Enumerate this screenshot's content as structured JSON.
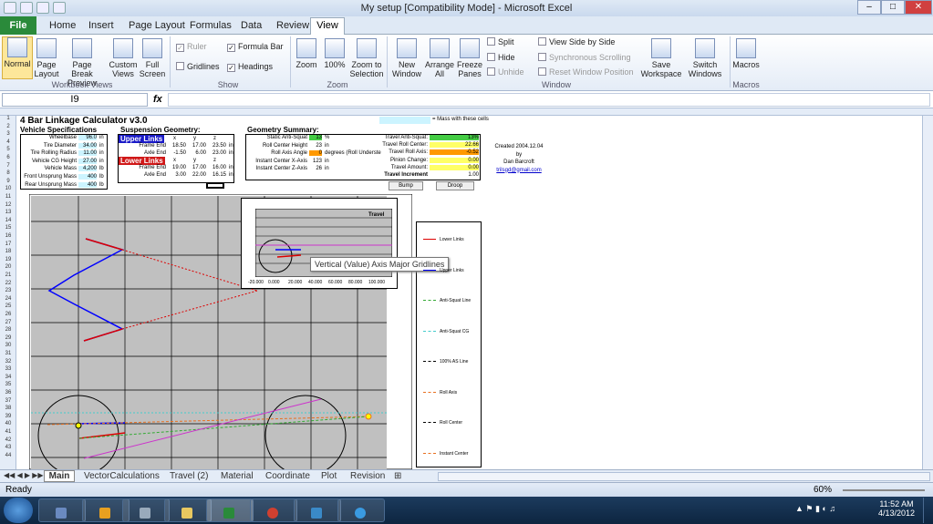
{
  "window": {
    "title": "My setup  [Compatibility Mode] - Microsoft Excel"
  },
  "ribbon_tabs": [
    "Home",
    "Insert",
    "Page Layout",
    "Formulas",
    "Data",
    "Review"
  ],
  "file_tab": "File",
  "active_tab": "View",
  "workbook_views": {
    "normal": "Normal",
    "page_layout": "Page Layout",
    "page_break": "Page Break Preview",
    "custom_views": "Custom Views",
    "full_screen": "Full Screen",
    "group": "Workbook Views"
  },
  "show": {
    "ruler": "Ruler",
    "formula_bar": "Formula Bar",
    "gridlines": "Gridlines",
    "headings": "Headings",
    "group": "Show"
  },
  "zoom": {
    "zoom": "Zoom",
    "z100": "100%",
    "zoom_sel": "Zoom to Selection",
    "group": "Zoom"
  },
  "window_grp": {
    "new_window": "New Window",
    "arrange_all": "Arrange All",
    "freeze": "Freeze Panes",
    "split": "Split",
    "hide": "Hide",
    "unhide": "Unhide",
    "side_by_side": "View Side by Side",
    "sync": "Synchronous Scrolling",
    "reset": "Reset Window Position",
    "save_ws": "Save Workspace",
    "switch": "Switch Windows",
    "group": "Window"
  },
  "macros": {
    "label": "Macros",
    "group": "Macros"
  },
  "namebox": "I9",
  "fx": "fx",
  "sheet": {
    "title": "4 Bar Linkage Calculator v3.0",
    "mass_note": "= Mass with these cells",
    "veh_hdr": "Vehicle Specifications",
    "veh": [
      [
        "Wheelbase",
        "96.0",
        "in"
      ],
      [
        "Tire Diameter",
        "34.00",
        "in"
      ],
      [
        "Tire Rolling Radius",
        "11.00",
        "in"
      ],
      [
        "Vehicle CG Height",
        "27.00",
        "in"
      ],
      [
        "Vehicle Mass",
        "4,200",
        "lb"
      ],
      [
        "Front Unsprung Mass",
        "400",
        "lb"
      ],
      [
        "Rear Unsprung Mass",
        "400",
        "lb"
      ]
    ],
    "susp_hdr": "Suspension Geometry:",
    "upper": "Upper Links",
    "lower": "Lower Links",
    "xyz": [
      "x",
      "y",
      "z"
    ],
    "upper_rows": [
      [
        "Frame End",
        "18.50",
        "17.00",
        "23.50"
      ],
      [
        "Axle End",
        "-1.50",
        "6.00",
        "23.00"
      ]
    ],
    "lower_rows": [
      [
        "Frame End",
        "19.00",
        "17.00",
        "16.00"
      ],
      [
        "Axle End",
        "3.00",
        "22.00",
        "16.15"
      ]
    ],
    "unit_in": "in",
    "geo_hdr": "Geometry Summary:",
    "geo": [
      [
        "Static Anti-Squat",
        "13",
        "%"
      ],
      [
        "Roll Center Height",
        "23",
        "in"
      ],
      [
        "Roll Axis Angle",
        "0",
        "degrees (Roll Underste"
      ],
      [
        "Instant Center X-Axis",
        "123",
        "in"
      ],
      [
        "Instant Center Z-Axis",
        "26",
        "in"
      ]
    ],
    "travel": [
      [
        "Travel Anti-Squat:",
        "13%"
      ],
      [
        "Travel Roll Center:",
        "22.66"
      ],
      [
        "Travel Roll Axis:",
        "-0.52"
      ],
      [
        "Pinion Change:",
        "0.00"
      ],
      [
        "Travel Amount:",
        "0.00"
      ],
      [
        "Travel Increment",
        "1.00"
      ]
    ],
    "created": [
      "Created 2004.12.04",
      "by",
      "Dan Barcroft",
      "trilsgd@gmail.com"
    ],
    "bump": "Bump",
    "droop": "Droop",
    "inset_title": "Travel",
    "inset_ticks": [
      "-20.000",
      "0.000",
      "20.000",
      "40.000",
      "60.000",
      "80.000",
      "100.000"
    ],
    "legend": [
      "Lower Links",
      "Upper Links",
      "Anti-Squat Line",
      "Anti-Squat CG",
      "100% AS Line",
      "Roll Axis",
      "Roll Center",
      "Instant Center"
    ],
    "tooltip": "Vertical (Value) Axis Major Gridlines"
  },
  "sheet_tabs": [
    "Main",
    "VectorCalculations",
    "Travel (2)",
    "Material",
    "Coordinate",
    "Plot",
    "Revision"
  ],
  "status": {
    "ready": "Ready",
    "zoom": "60%"
  },
  "clock": {
    "time": "11:52 AM",
    "date": "4/13/2012"
  }
}
